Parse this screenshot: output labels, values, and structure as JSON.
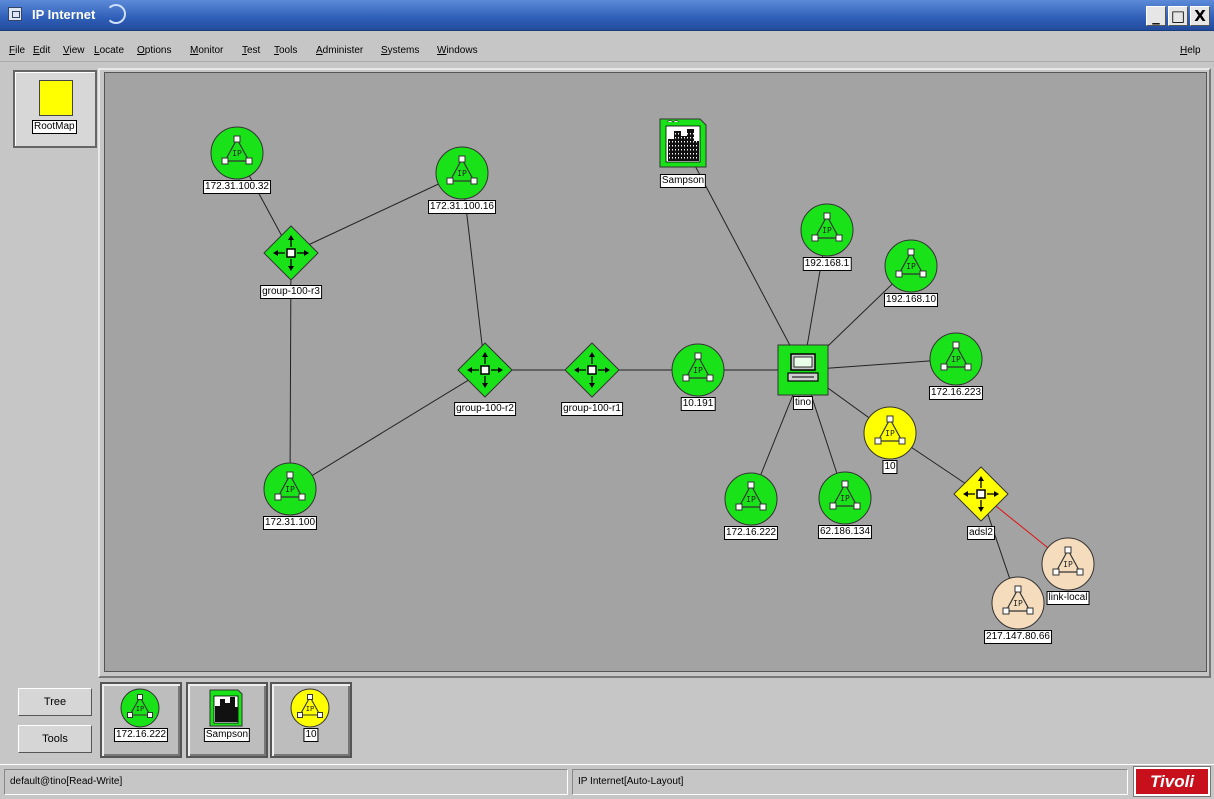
{
  "window": {
    "title": "IP Internet",
    "controls": {
      "minimize": "_",
      "maximize": "□",
      "close": "X"
    }
  },
  "menubar": {
    "items": [
      "File",
      "Edit",
      "View",
      "Locate",
      "Options",
      "Monitor",
      "Test",
      "Tools",
      "Administer",
      "Systems",
      "Windows"
    ],
    "help": "Help"
  },
  "rootmap": {
    "label": "RootMap",
    "color": "#ffff00"
  },
  "colors": {
    "normal": "#19e219",
    "warning": "#ffff00",
    "unknown": "#f4dcbc",
    "canvas": "#a3a3a3",
    "red_link": "#e01010"
  },
  "map": {
    "nodes": [
      {
        "id": "n1",
        "label": "172.31.100.32",
        "type": "network",
        "status": "normal",
        "icon": "ip-network-icon"
      },
      {
        "id": "n2",
        "label": "172.31.100.16",
        "type": "network",
        "status": "normal",
        "icon": "ip-network-icon"
      },
      {
        "id": "n3",
        "label": "group-100-r3",
        "type": "router",
        "status": "normal",
        "icon": "router-icon"
      },
      {
        "id": "n4",
        "label": "group-100-r2",
        "type": "router",
        "status": "normal",
        "icon": "router-icon"
      },
      {
        "id": "n5",
        "label": "group-100-r1",
        "type": "router",
        "status": "normal",
        "icon": "router-icon"
      },
      {
        "id": "n6",
        "label": "10.191",
        "type": "network",
        "status": "normal",
        "icon": "ip-network-icon"
      },
      {
        "id": "n7",
        "label": "172.31.100",
        "type": "network",
        "status": "normal",
        "icon": "ip-network-icon"
      },
      {
        "id": "n8",
        "label": "Sampson",
        "type": "city",
        "status": "normal",
        "icon": "city-icon"
      },
      {
        "id": "n9",
        "label": "192.168.1",
        "type": "network",
        "status": "normal",
        "icon": "ip-network-icon"
      },
      {
        "id": "n10",
        "label": "192.168.10",
        "type": "network",
        "status": "normal",
        "icon": "ip-network-icon"
      },
      {
        "id": "n11",
        "label": "tino",
        "type": "computer",
        "status": "normal",
        "icon": "computer-icon"
      },
      {
        "id": "n12",
        "label": "172.16.223",
        "type": "network",
        "status": "normal",
        "icon": "ip-network-icon"
      },
      {
        "id": "n13",
        "label": "10",
        "type": "network",
        "status": "warning",
        "icon": "ip-network-icon"
      },
      {
        "id": "n14",
        "label": "172.16.222",
        "type": "network",
        "status": "normal",
        "icon": "ip-network-icon"
      },
      {
        "id": "n15",
        "label": "62.186.134",
        "type": "network",
        "status": "normal",
        "icon": "ip-network-icon"
      },
      {
        "id": "n16",
        "label": "adsl2",
        "type": "router",
        "status": "warning",
        "icon": "router-icon"
      },
      {
        "id": "n17",
        "label": "link-local",
        "type": "network",
        "status": "unknown",
        "icon": "ip-network-icon"
      },
      {
        "id": "n18",
        "label": "217.147.80.66",
        "type": "network",
        "status": "unknown",
        "icon": "ip-network-icon"
      }
    ],
    "links": [
      {
        "from": "n1",
        "to": "n3",
        "status": "normal"
      },
      {
        "from": "n2",
        "to": "n3",
        "status": "normal"
      },
      {
        "from": "n3",
        "to": "n7",
        "status": "normal"
      },
      {
        "from": "n7",
        "to": "n4",
        "status": "normal"
      },
      {
        "from": "n2",
        "to": "n4",
        "status": "normal"
      },
      {
        "from": "n4",
        "to": "n5",
        "status": "normal"
      },
      {
        "from": "n5",
        "to": "n6",
        "status": "normal"
      },
      {
        "from": "n6",
        "to": "n11",
        "status": "normal"
      },
      {
        "from": "n8",
        "to": "n11",
        "status": "normal"
      },
      {
        "from": "n9",
        "to": "n11",
        "status": "normal"
      },
      {
        "from": "n10",
        "to": "n11",
        "status": "normal"
      },
      {
        "from": "n12",
        "to": "n11",
        "status": "normal"
      },
      {
        "from": "n13",
        "to": "n11",
        "status": "normal"
      },
      {
        "from": "n14",
        "to": "n11",
        "status": "normal"
      },
      {
        "from": "n15",
        "to": "n11",
        "status": "normal"
      },
      {
        "from": "n13",
        "to": "n16",
        "status": "normal"
      },
      {
        "from": "n16",
        "to": "n17",
        "status": "critical"
      },
      {
        "from": "n16",
        "to": "n18",
        "status": "normal"
      }
    ]
  },
  "side_buttons": {
    "tree": "Tree",
    "tools": "Tools"
  },
  "tray": [
    {
      "label": "172.16.222",
      "type": "network",
      "status": "normal",
      "icon": "ip-network-icon"
    },
    {
      "label": "Sampson",
      "type": "city",
      "status": "normal",
      "icon": "city-icon"
    },
    {
      "label": "10",
      "type": "network",
      "status": "warning",
      "icon": "ip-network-icon"
    }
  ],
  "status": {
    "left": "default@tino[Read-Write]",
    "right": "IP Internet[Auto-Layout]",
    "logo": "Tivoli"
  }
}
